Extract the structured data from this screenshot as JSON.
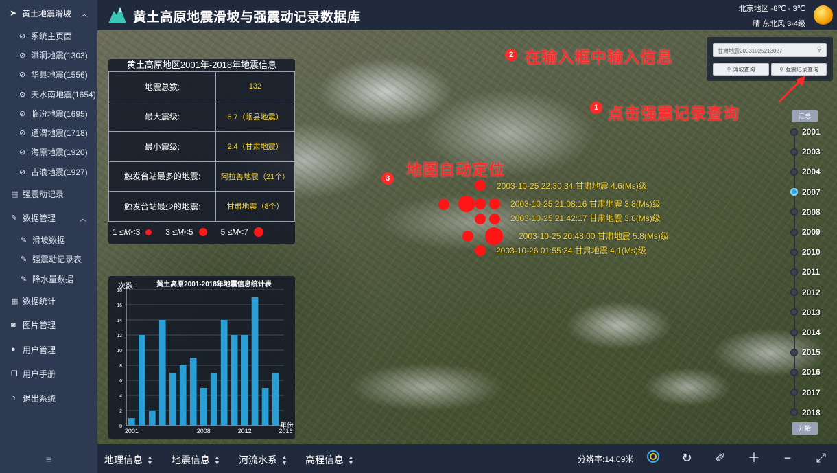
{
  "app": {
    "title": "黄土高原地震滑坡与强震动记录数据库"
  },
  "weather": {
    "city_temp": "北京地区 -8℃ - 3℃",
    "wind": "晴  东北风 3-4级"
  },
  "sidebar": {
    "group_label": "黄土地震滑坡",
    "sub_items": [
      {
        "label": "系统主页面"
      },
      {
        "label": "洪洞地震(1303)"
      },
      {
        "label": "华县地震(1556)"
      },
      {
        "label": "天水南地震(1654)"
      },
      {
        "label": "临汾地震(1695)"
      },
      {
        "label": "通渭地震(1718)"
      },
      {
        "label": "海原地震(1920)"
      },
      {
        "label": "古浪地震(1927)"
      }
    ],
    "strong_motion": "强震动记录",
    "data_mgmt": "数据管理",
    "data_sub": [
      {
        "label": "滑坡数据"
      },
      {
        "label": "强震动记录表"
      },
      {
        "label": "降水量数据"
      }
    ],
    "stats": "数据统计",
    "images": "图片管理",
    "users": "用户管理",
    "manual": "用户手册",
    "logout": "退出系统",
    "bottom_icon": "≡"
  },
  "info_panel": {
    "title": "黄土高原地区2001年-2018年地震信息",
    "rows": [
      {
        "label": "地震总数:",
        "value": "132"
      },
      {
        "label": "最大震级:",
        "value": "6.7（岷县地震）"
      },
      {
        "label": "最小震级:",
        "value": "2.4（甘肃地震）"
      },
      {
        "label": "触发台站最多的地震:",
        "value": "阿拉善地震（21个）"
      },
      {
        "label": "触发台站最少的地震:",
        "value": "甘肃地震（8个）"
      }
    ],
    "legend": [
      {
        "label_a": "1 ≤ ",
        "m": "M",
        "label_b": " <3"
      },
      {
        "label_a": "3 ≤ ",
        "m": "M",
        "label_b": " <5"
      },
      {
        "label_a": "5 ≤ ",
        "m": "M",
        "label_b": " <7"
      }
    ]
  },
  "chart_data": {
    "type": "bar",
    "title": "黄土高原2001-2018年地震信息统计表",
    "ylabel": "次数",
    "xlabel": "年份",
    "categories": [
      "2001",
      "2002",
      "2003",
      "2004",
      "2005",
      "2006",
      "2007",
      "2008",
      "2009",
      "2010",
      "2011",
      "2012",
      "2013",
      "2014",
      "2015",
      "2016",
      "2017",
      "2018"
    ],
    "values": [
      1,
      12,
      2,
      14,
      7,
      8,
      9,
      5,
      7,
      14,
      12,
      12,
      17,
      5,
      7
    ],
    "x": [
      2001,
      2002,
      2003,
      2004,
      2005,
      2006,
      2007,
      2008,
      2009,
      2010,
      2011,
      2012,
      2013,
      2014,
      2015,
      2016,
      2017,
      2018
    ],
    "bar_years": [
      2001,
      2002,
      2003,
      2004,
      2005,
      2006,
      2007,
      2008,
      2009,
      2010,
      2011,
      2012,
      2013,
      2014,
      2015,
      2016,
      2017,
      2018
    ],
    "bar_values": [
      1,
      12,
      2,
      14,
      7,
      8,
      9,
      5,
      7,
      14,
      12,
      12,
      17,
      5,
      7,
      0,
      0,
      0
    ],
    "xticks": [
      "2001",
      "2008",
      "2012",
      "2016"
    ],
    "yticks": [
      0,
      2,
      4,
      6,
      8,
      10,
      12,
      14,
      16,
      18
    ],
    "ylim": [
      0,
      18
    ],
    "grid": true,
    "bar_color": "#2a9fd6"
  },
  "search": {
    "value": "甘肃地震20031025213027",
    "btn_landslide": "滑坡查询",
    "btn_strong": "强震记录查询"
  },
  "annotations": {
    "step1": "点击强震记录查询",
    "step2": "在输入框中输入信息",
    "step3": "地图自动定位",
    "n1": "1",
    "n2": "2",
    "n3": "3"
  },
  "quakes": [
    {
      "label": "2003-10-25 22:30:34 甘肃地震 4.6(Ms)级"
    },
    {
      "label": "2003-10-25 21:08:16 甘肃地震 3.8(Ms)级"
    },
    {
      "label": "2003-10-25 21:42:17 甘肃地震 3.8(Ms)级"
    },
    {
      "label": "2003-10-25 20:48:00 甘肃地震 5.8(Ms)级"
    },
    {
      "label": "2003-10-26 01:55:34 甘肃地震 4.1(Ms)级"
    }
  ],
  "timeline": {
    "summary": "汇总",
    "start": "开始",
    "years": [
      "2001",
      "2003",
      "2004",
      "2007",
      "2008",
      "2009",
      "2010",
      "2011",
      "2012",
      "2013",
      "2014",
      "2015",
      "2016",
      "2017",
      "2018"
    ],
    "active": "2007"
  },
  "bottom": {
    "geo": "地理信息",
    "quake": "地震信息",
    "river": "河流水系",
    "elev": "高程信息",
    "resolution": "分辨率:14.09米"
  },
  "colors": {
    "accent": "#2fa9e6",
    "quake": "#ff1515",
    "annotation": "#ff2a2a",
    "label": "#f2d33a"
  }
}
